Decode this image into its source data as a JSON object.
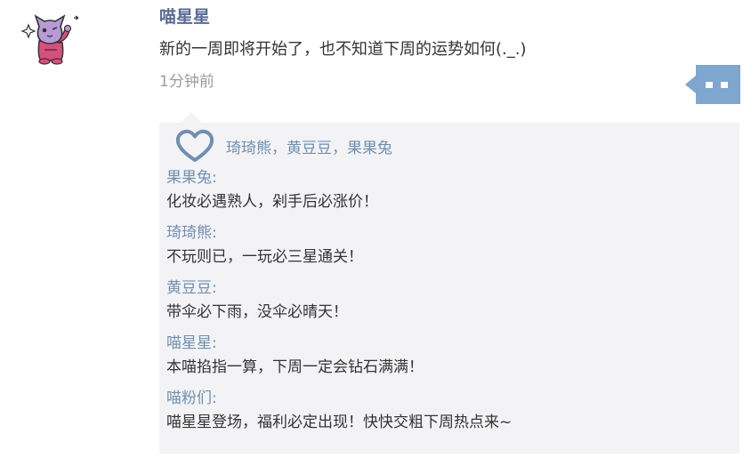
{
  "post": {
    "author": "喵星星",
    "text": "新的一周即将开始了，也不知道下周的运势如何(._.)",
    "time": "1分钟前",
    "avatar_icon": "purple-cat-avatar-icon",
    "more_icon": "more-comment-icon"
  },
  "likes": {
    "icon": "heart-outline-icon",
    "names": "琦琦熊，黄豆豆，果果兔"
  },
  "comments": [
    {
      "author": "果果兔:",
      "text": "化妆必遇熟人，剁手后必涨价！"
    },
    {
      "author": "琦琦熊:",
      "text": "不玩则已，一玩必三星通关！"
    },
    {
      "author": "黄豆豆:",
      "text": "带伞必下雨，没伞必晴天！"
    },
    {
      "author": "喵星星:",
      "text": "本喵掐指一算，下周一定会钻石满满！"
    },
    {
      "author": "喵粉们:",
      "text": "喵星星登场，福利必定出现！快快交粗下周热点来~"
    }
  ],
  "colors": {
    "username": "#576b95",
    "link_blue": "#6f8fb1",
    "panel_bg": "#f3f3f6",
    "button_blue": "#7ea6cf"
  }
}
